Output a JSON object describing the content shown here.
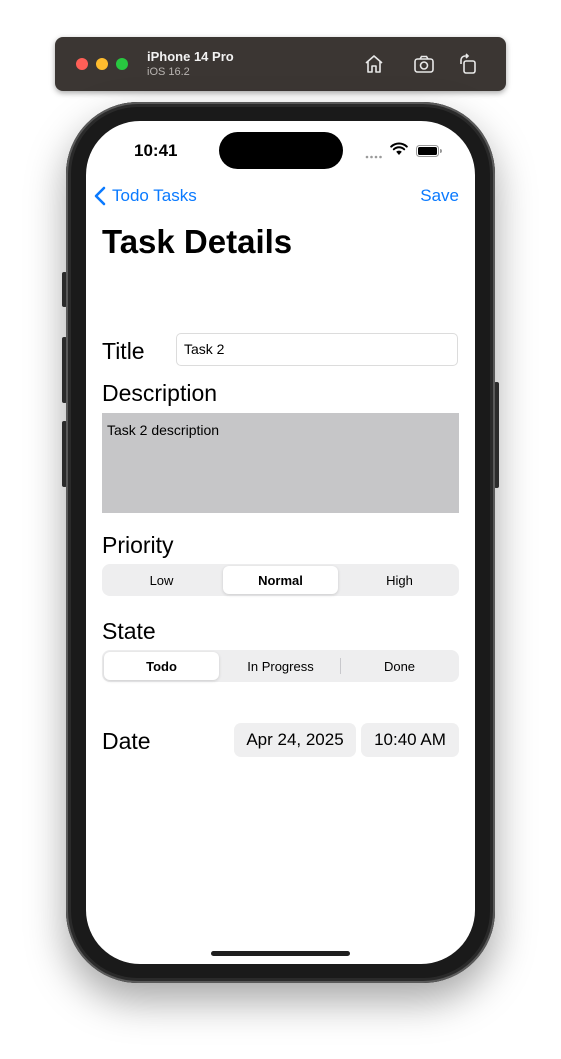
{
  "simulator": {
    "device": "iPhone 14 Pro",
    "os": "iOS 16.2",
    "icons": [
      "home-icon",
      "screenshot-icon",
      "rotate-icon"
    ]
  },
  "status_bar": {
    "time": "10:41"
  },
  "nav": {
    "back_label": "Todo Tasks",
    "save_label": "Save"
  },
  "page": {
    "title": "Task Details"
  },
  "form": {
    "title_label": "Title",
    "title_value": "Task 2",
    "description_label": "Description",
    "description_value": "Task 2 description",
    "priority_label": "Priority",
    "priority_options": [
      "Low",
      "Normal",
      "High"
    ],
    "priority_selected": "Normal",
    "state_label": "State",
    "state_options": [
      "Todo",
      "In Progress",
      "Done"
    ],
    "state_selected": "Todo",
    "date_label": "Date",
    "date_value": "Apr 24, 2025",
    "time_value": "10:40 AM"
  },
  "colors": {
    "accent": "#0a7aff",
    "description_bg": "#c6c6c8",
    "segment_bg": "#eeeeef"
  }
}
